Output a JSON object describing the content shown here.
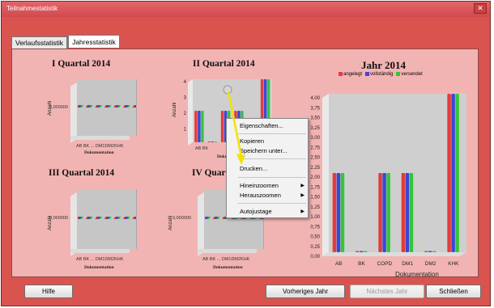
{
  "window": {
    "title": "Teilnahmestatistik"
  },
  "tabs": [
    "Verlaufsstatistik",
    "Jahresstatistik"
  ],
  "charts_small": [
    {
      "title": "I Quartal 2014",
      "ylabel": "Anzahl",
      "zero_label": "0,000000",
      "categories": "AB  BK  ...  DM1DM2KHK",
      "xlabel": "Dokumentation"
    },
    {
      "title": "II Quartal 2014",
      "ylabel": "Anzahl",
      "categories": "AB  BK",
      "xlabel": "Doku"
    },
    {
      "title": "III Quartal 2014",
      "ylabel": "Anzahl",
      "zero_label": "0,000000",
      "categories": "AB  BK  ...  DM1DM2KHK",
      "xlabel": "Dokumentation"
    },
    {
      "title": "IV Quart",
      "ylabel": "Anzahl",
      "zero_label": "0,000000",
      "categories": "AB  BK  ...  DM1DM2KHK",
      "xlabel": "Dokumentation"
    }
  ],
  "chart_data": [
    {
      "type": "bar",
      "title": "II Quartal 2014",
      "ylabel": "Anzahl",
      "categories": [
        "AB",
        "BK",
        "COPD",
        "DM1",
        "DM2",
        "KHK"
      ],
      "ylim": [
        0,
        4
      ],
      "yticks": [
        "4",
        "3",
        "2",
        "1"
      ],
      "series": [
        {
          "name": "angelegt",
          "values": [
            2,
            0,
            2,
            2,
            0,
            4
          ]
        },
        {
          "name": "vollständig",
          "values": [
            2,
            0,
            2,
            2,
            0,
            4
          ]
        },
        {
          "name": "versendet",
          "values": [
            2,
            0,
            2,
            2,
            0,
            4
          ]
        }
      ]
    },
    {
      "type": "bar",
      "title": "Jahr 2014",
      "xlabel": "Dokumentation",
      "categories": [
        "AB",
        "BK",
        "COPD",
        "DM1",
        "DM2",
        "KHK"
      ],
      "ylim": [
        0,
        4
      ],
      "yticks": [
        "4,00",
        "3,75",
        "3,50",
        "3,25",
        "3,00",
        "2,75",
        "2,50",
        "2,25",
        "2,00",
        "1,75",
        "1,50",
        "1,25",
        "1,00",
        "0,75",
        "0,50",
        "0,25",
        "0,00"
      ],
      "series": [
        {
          "name": "angelegt",
          "color": "#e53b3b",
          "values": [
            2,
            0,
            2,
            2,
            0,
            4
          ]
        },
        {
          "name": "vollständig",
          "color": "#3b46d8",
          "values": [
            2,
            0,
            2,
            2,
            0,
            4
          ]
        },
        {
          "name": "versendet",
          "color": "#35c43a",
          "values": [
            2,
            0,
            2,
            2,
            0,
            4
          ]
        }
      ],
      "legend": "top"
    }
  ],
  "context_menu": {
    "items": [
      {
        "label": "Eigenschaften..."
      },
      {
        "label": "Kopieren"
      },
      {
        "label": "Speichern unter..."
      },
      {
        "label": "Drucken..."
      },
      {
        "label": "Hineinzoomen",
        "submenu": true
      },
      {
        "label": "Herauszoomen",
        "submenu": true
      },
      {
        "label": "Autojustage",
        "submenu": true
      }
    ]
  },
  "buttons": {
    "help": "Hilfe",
    "prev": "Vorheriges Jahr",
    "next": "Nächstes Jahr",
    "close": "Schließen"
  }
}
